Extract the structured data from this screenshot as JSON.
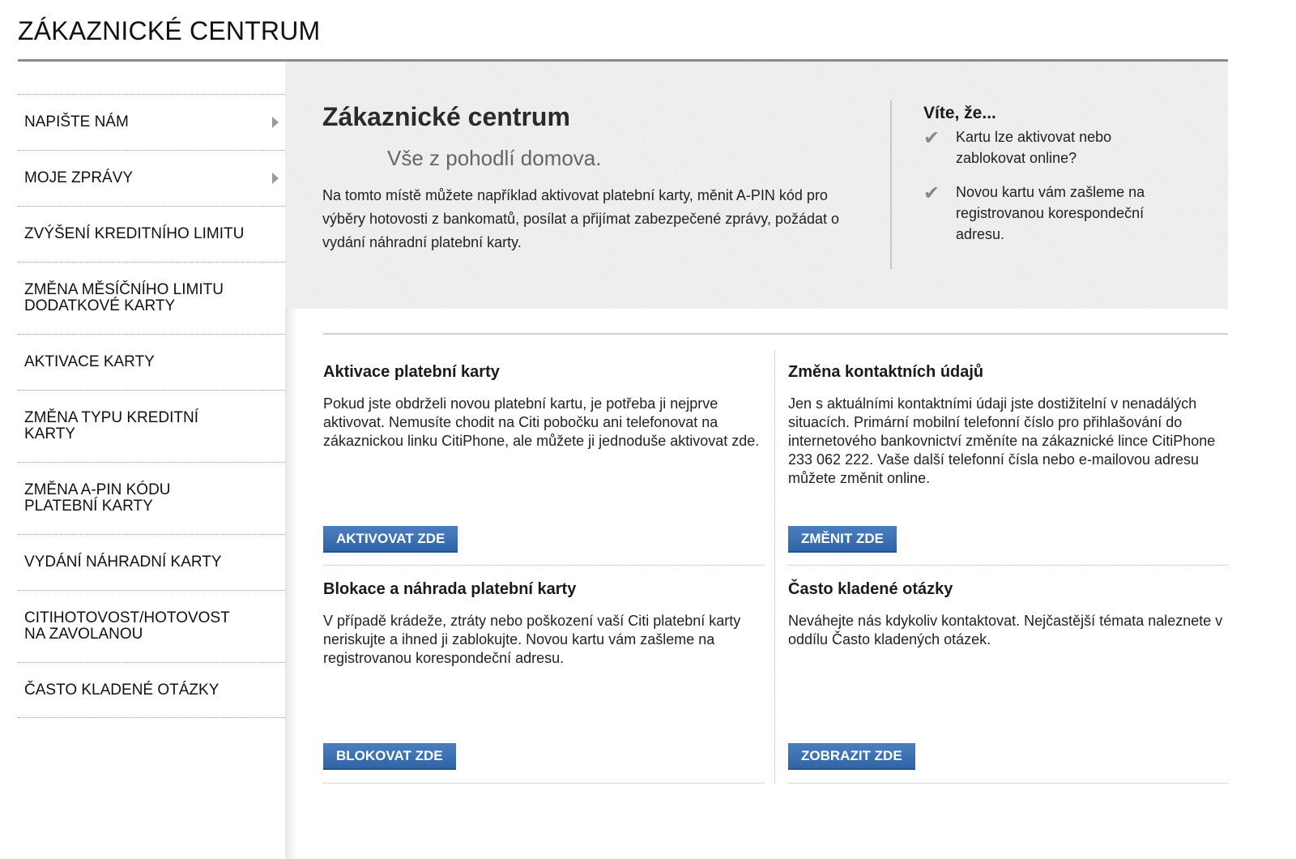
{
  "header": {
    "title": "ZÁKAZNICKÉ CENTRUM"
  },
  "sidebar": {
    "items": [
      {
        "label": "NAPIŠTE NÁM",
        "has_arrow": true
      },
      {
        "label": "MOJE ZPRÁVY",
        "has_arrow": true
      },
      {
        "label": "ZVÝŠENÍ KREDITNÍHO LIMITU"
      },
      {
        "label": "ZMĚNA MĚSÍČNÍHO LIMITU DODATKOVÉ KARTY"
      },
      {
        "label": "AKTIVACE KARTY"
      },
      {
        "label": "ZMĚNA TYPU KREDITNÍ KARTY"
      },
      {
        "label": "ZMĚNA A-PIN KÓDU PLATEBNÍ KARTY"
      },
      {
        "label": "VYDÁNÍ NÁHRADNÍ KARTY"
      },
      {
        "label": "CITIHOTOVOST/HOTOVOST NA ZAVOLANOU"
      },
      {
        "label": "ČASTO KLADENÉ OTÁZKY"
      }
    ]
  },
  "hero": {
    "title": "Zákaznické centrum",
    "subtitle": "Vše z pohodlí domova.",
    "text": "Na tomto místě můžete například aktivovat platební karty, měnit A-PIN kód pro výběry hotovosti z bankomatů, posílat a přijímat zabezpečené zprávy, požádat o vydání náhradní platební karty.",
    "did_you_know": {
      "title": "Víte, že...",
      "tips": [
        "Kartu lze aktivovat nebo zablokovat online?",
        "Novou kartu vám zašleme na registrovanou korespondeční adresu."
      ]
    }
  },
  "cards": [
    {
      "title": "Aktivace platební karty",
      "text": "Pokud jste obdrželi novou platební kartu, je potřeba ji nejprve aktivovat. Nemusíte chodit na Citi pobočku ani telefonovat na zákaznickou linku CitiPhone, ale můžete ji jednoduše aktivovat zde.",
      "button": "AKTIVOVAT ZDE"
    },
    {
      "title": "Změna kontaktních údajů",
      "text": "Jen s aktuálními kontaktními údaji jste dostižitelní v nenadálých situacích. Primární mobilní telefonní číslo pro přihlašování do internetového bankovnictví změníte na zákaznické lince CitiPhone 233 062 222. Vaše další telefonní čísla nebo e-mailovou adresu můžete změnit online.",
      "button": "ZMĚNIT ZDE"
    },
    {
      "title": "Blokace a náhrada platební karty",
      "text": "V případě krádeže, ztráty nebo poškození vaší Citi platební karty neriskujte a ihned ji zablokujte. Novou kartu vám zašleme na registrovanou korespondeční adresu.",
      "button": "BLOKOVAT ZDE"
    },
    {
      "title": "Často kladené otázky",
      "text": "Neváhejte nás kdykoliv kontaktovat. Nejčastější témata naleznete v oddílu Často kladených otázek.",
      "button": "ZOBRAZIT ZDE"
    }
  ]
}
